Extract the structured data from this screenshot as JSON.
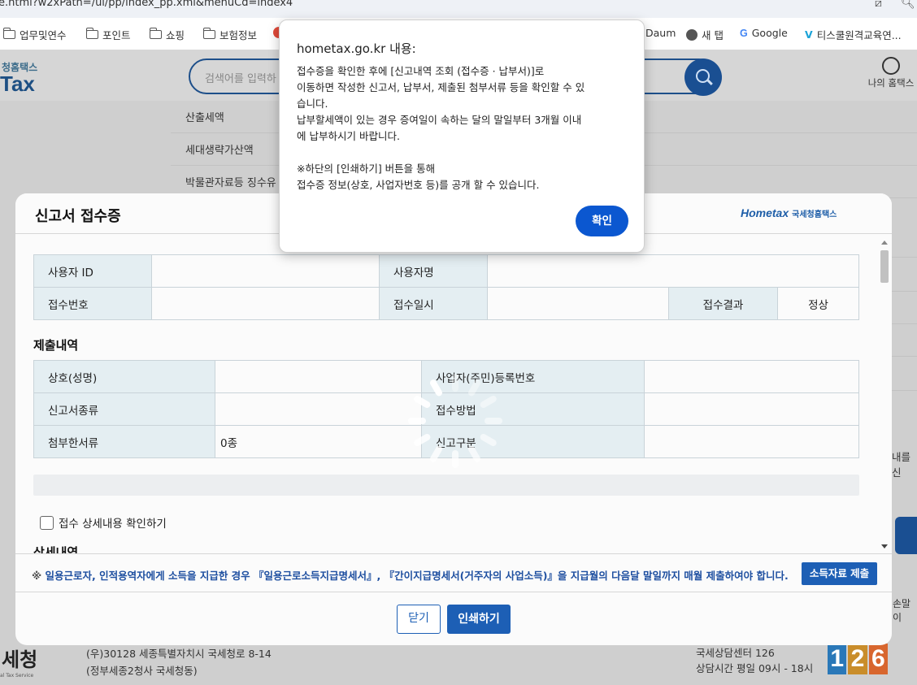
{
  "browser": {
    "url": "e.html?w2xPath=/ui/pp/index_pp.xml&menuCd=index4",
    "bookmarks": [
      {
        "label": "업무및연수",
        "icon": "folder-icon"
      },
      {
        "label": "포인트",
        "icon": "folder-icon"
      },
      {
        "label": "쇼핑",
        "icon": "folder-icon"
      },
      {
        "label": "보험정보",
        "icon": "folder-icon"
      },
      {
        "label": "Daum",
        "icon": "daum-icon"
      },
      {
        "label": "새 탭",
        "icon": "globe-icon"
      },
      {
        "label": "Google",
        "icon": "google-icon"
      },
      {
        "label": "티스쿨원격교육연...",
        "icon": "tschool-icon"
      }
    ]
  },
  "site": {
    "logo_small": "청홈택스",
    "logo_main": "Tax",
    "search_placeholder": "검색어를 입력하",
    "my_hometax": "나의 홈택스",
    "side_menu": [
      "산출세액",
      "세대생략가산액",
      "박물관자료등 징수유"
    ],
    "right_fragments": [
      "내를 신",
      "손말이"
    ],
    "footer": {
      "logo": "세청",
      "logo_sub": "al Tax Service",
      "address_line1": "(우)30128 세종특별자치시 국세청로 8-14",
      "address_line2": "(정부세종2청사 국세청동)",
      "center_line1": "국세상담센터 126",
      "center_line2": "상담시간 평일 09시 - 18시",
      "num_digits": [
        "1",
        "2",
        "6"
      ]
    }
  },
  "modal": {
    "title": "신고서 접수증",
    "logo_main": "Hometax",
    "logo_sub": "국세청홈택스",
    "table1": {
      "user_id_label": "사용자 ID",
      "user_id_value": "",
      "user_name_label": "사용자명",
      "user_name_value": "",
      "receipt_no_label": "접수번호",
      "receipt_no_value": "",
      "receipt_date_label": "접수일시",
      "receipt_date_value": "",
      "result_label": "접수결과",
      "result_value": "정상"
    },
    "submission_title": "제출내역",
    "table2": {
      "trade_name_label": "상호(성명)",
      "trade_name_value": "",
      "reg_no_label": "사업자(주민)등록번호",
      "reg_no_value": "",
      "report_type_label": "신고서종류",
      "report_type_value": "",
      "method_label": "접수방법",
      "method_value": "",
      "attach_label": "첨부한서류",
      "attach_value": "0종",
      "category_label": "신고구분",
      "category_value": ""
    },
    "detail_checkbox": "접수 상세내용 확인하기",
    "detail_title": "상세내역",
    "notice_mark": "※",
    "notice": "일용근로자, 인적용역자에게 소득을 지급한 경우 『일용근로소득지급명세서』, 『간이지급명세서(거주자의 사업소득)』을 지급월의 다음달 말일까지 매월 제출하여야 합니다.",
    "submit_income": "소득자료 제출",
    "close": "닫기",
    "print": "인쇄하기"
  },
  "alert": {
    "title": "hometax.go.kr 내용:",
    "message": "접수증을 확인한 후에 [신고내역 조회 (접수증 · 납부서)]로\n이동하면 작성한 신고서, 납부서, 제출된 첨부서류 등을 확인할 수 있\n습니다.\n납부할세액이 있는 경우 증여일이 속하는 달의 말일부터 3개월 이내\n에 납부하시기 바랍니다.\n\n※하단의 [인쇄하기] 버튼을 통해\n접수증 정보(상호, 사업자번호 등)를 공개 할 수 있습니다.",
    "ok": "확인"
  },
  "colors": {
    "primary": "#1d5fb5",
    "alert_ok": "#0b57d0",
    "header_cell": "#e4eef2",
    "notice_text": "#1e4fa0"
  }
}
